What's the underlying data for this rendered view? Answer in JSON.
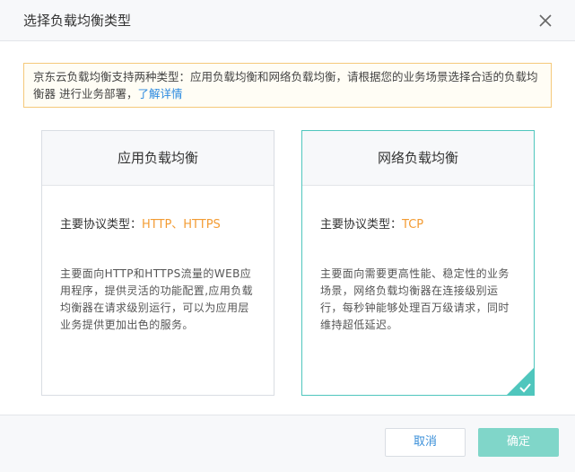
{
  "dialog": {
    "title": "选择负载均衡类型",
    "close_icon": "close-icon"
  },
  "notice": {
    "text": "京东云负载均衡支持两种类型：应用负载均衡和网络负载均衡，请根据您的业务场景选择合适的负载均衡器 进行业务部署，",
    "link_text": "了解详情"
  },
  "cards": [
    {
      "title": "应用负载均衡",
      "protocol_label": "主要协议类型：",
      "protocol_value": "HTTP、HTTPS",
      "description": "主要面向HTTP和HTTPS流量的WEB应用程序，提供灵活的功能配置,应用负载均衡器在请求级别运行，可以为应用层业务提供更加出色的服务。",
      "selected": false
    },
    {
      "title": "网络负载均衡",
      "protocol_label": "主要协议类型：",
      "protocol_value": "TCP",
      "description": "主要面向需要更高性能、稳定性的业务场景，网络负载均衡器在连接级别运行，每秒钟能够处理百万级请求，同时维持超低延迟。",
      "selected": true
    }
  ],
  "footer": {
    "cancel_label": "取消",
    "ok_label": "确定"
  },
  "colors": {
    "accent": "#4fc6bd",
    "link": "#2b8ae0",
    "protocol_value": "#f39c34",
    "notice_border": "#f5c97a"
  }
}
